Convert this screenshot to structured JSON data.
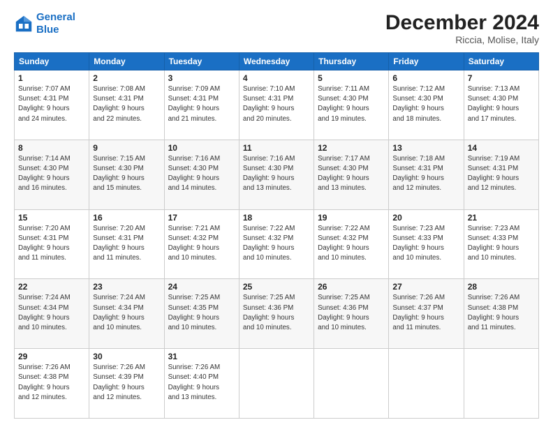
{
  "logo": {
    "line1": "General",
    "line2": "Blue"
  },
  "header": {
    "month": "December 2024",
    "location": "Riccia, Molise, Italy"
  },
  "days_of_week": [
    "Sunday",
    "Monday",
    "Tuesday",
    "Wednesday",
    "Thursday",
    "Friday",
    "Saturday"
  ],
  "weeks": [
    [
      {
        "day": "1",
        "info": "Sunrise: 7:07 AM\nSunset: 4:31 PM\nDaylight: 9 hours\nand 24 minutes."
      },
      {
        "day": "2",
        "info": "Sunrise: 7:08 AM\nSunset: 4:31 PM\nDaylight: 9 hours\nand 22 minutes."
      },
      {
        "day": "3",
        "info": "Sunrise: 7:09 AM\nSunset: 4:31 PM\nDaylight: 9 hours\nand 21 minutes."
      },
      {
        "day": "4",
        "info": "Sunrise: 7:10 AM\nSunset: 4:31 PM\nDaylight: 9 hours\nand 20 minutes."
      },
      {
        "day": "5",
        "info": "Sunrise: 7:11 AM\nSunset: 4:30 PM\nDaylight: 9 hours\nand 19 minutes."
      },
      {
        "day": "6",
        "info": "Sunrise: 7:12 AM\nSunset: 4:30 PM\nDaylight: 9 hours\nand 18 minutes."
      },
      {
        "day": "7",
        "info": "Sunrise: 7:13 AM\nSunset: 4:30 PM\nDaylight: 9 hours\nand 17 minutes."
      }
    ],
    [
      {
        "day": "8",
        "info": "Sunrise: 7:14 AM\nSunset: 4:30 PM\nDaylight: 9 hours\nand 16 minutes."
      },
      {
        "day": "9",
        "info": "Sunrise: 7:15 AM\nSunset: 4:30 PM\nDaylight: 9 hours\nand 15 minutes."
      },
      {
        "day": "10",
        "info": "Sunrise: 7:16 AM\nSunset: 4:30 PM\nDaylight: 9 hours\nand 14 minutes."
      },
      {
        "day": "11",
        "info": "Sunrise: 7:16 AM\nSunset: 4:30 PM\nDaylight: 9 hours\nand 13 minutes."
      },
      {
        "day": "12",
        "info": "Sunrise: 7:17 AM\nSunset: 4:30 PM\nDaylight: 9 hours\nand 13 minutes."
      },
      {
        "day": "13",
        "info": "Sunrise: 7:18 AM\nSunset: 4:31 PM\nDaylight: 9 hours\nand 12 minutes."
      },
      {
        "day": "14",
        "info": "Sunrise: 7:19 AM\nSunset: 4:31 PM\nDaylight: 9 hours\nand 12 minutes."
      }
    ],
    [
      {
        "day": "15",
        "info": "Sunrise: 7:20 AM\nSunset: 4:31 PM\nDaylight: 9 hours\nand 11 minutes."
      },
      {
        "day": "16",
        "info": "Sunrise: 7:20 AM\nSunset: 4:31 PM\nDaylight: 9 hours\nand 11 minutes."
      },
      {
        "day": "17",
        "info": "Sunrise: 7:21 AM\nSunset: 4:32 PM\nDaylight: 9 hours\nand 10 minutes."
      },
      {
        "day": "18",
        "info": "Sunrise: 7:22 AM\nSunset: 4:32 PM\nDaylight: 9 hours\nand 10 minutes."
      },
      {
        "day": "19",
        "info": "Sunrise: 7:22 AM\nSunset: 4:32 PM\nDaylight: 9 hours\nand 10 minutes."
      },
      {
        "day": "20",
        "info": "Sunrise: 7:23 AM\nSunset: 4:33 PM\nDaylight: 9 hours\nand 10 minutes."
      },
      {
        "day": "21",
        "info": "Sunrise: 7:23 AM\nSunset: 4:33 PM\nDaylight: 9 hours\nand 10 minutes."
      }
    ],
    [
      {
        "day": "22",
        "info": "Sunrise: 7:24 AM\nSunset: 4:34 PM\nDaylight: 9 hours\nand 10 minutes."
      },
      {
        "day": "23",
        "info": "Sunrise: 7:24 AM\nSunset: 4:34 PM\nDaylight: 9 hours\nand 10 minutes."
      },
      {
        "day": "24",
        "info": "Sunrise: 7:25 AM\nSunset: 4:35 PM\nDaylight: 9 hours\nand 10 minutes."
      },
      {
        "day": "25",
        "info": "Sunrise: 7:25 AM\nSunset: 4:36 PM\nDaylight: 9 hours\nand 10 minutes."
      },
      {
        "day": "26",
        "info": "Sunrise: 7:25 AM\nSunset: 4:36 PM\nDaylight: 9 hours\nand 10 minutes."
      },
      {
        "day": "27",
        "info": "Sunrise: 7:26 AM\nSunset: 4:37 PM\nDaylight: 9 hours\nand 11 minutes."
      },
      {
        "day": "28",
        "info": "Sunrise: 7:26 AM\nSunset: 4:38 PM\nDaylight: 9 hours\nand 11 minutes."
      }
    ],
    [
      {
        "day": "29",
        "info": "Sunrise: 7:26 AM\nSunset: 4:38 PM\nDaylight: 9 hours\nand 12 minutes."
      },
      {
        "day": "30",
        "info": "Sunrise: 7:26 AM\nSunset: 4:39 PM\nDaylight: 9 hours\nand 12 minutes."
      },
      {
        "day": "31",
        "info": "Sunrise: 7:26 AM\nSunset: 4:40 PM\nDaylight: 9 hours\nand 13 minutes."
      },
      {
        "day": "",
        "info": ""
      },
      {
        "day": "",
        "info": ""
      },
      {
        "day": "",
        "info": ""
      },
      {
        "day": "",
        "info": ""
      }
    ]
  ]
}
